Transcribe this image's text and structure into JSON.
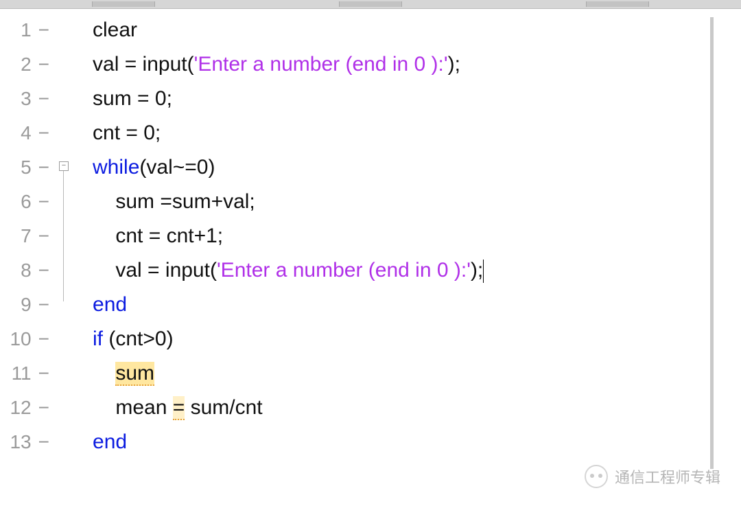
{
  "gutter": {
    "nums": [
      "1",
      "2",
      "3",
      "4",
      "5",
      "6",
      "7",
      "8",
      "9",
      "10",
      "11",
      "12",
      "13"
    ],
    "dash": "−"
  },
  "fold": {
    "minus": "−"
  },
  "code": {
    "l1": {
      "text": "clear"
    },
    "l2": {
      "a": "val = input(",
      "s": "'Enter a number (end in 0 ):'",
      "b": ");"
    },
    "l3": {
      "text": "sum = 0;"
    },
    "l4": {
      "text": "cnt = 0;"
    },
    "l5": {
      "kw": "while",
      "rest": "(val~=0)"
    },
    "l6": {
      "text": "sum =sum+val;"
    },
    "l7": {
      "text": "cnt = cnt+1;"
    },
    "l8": {
      "a": "val = input(",
      "s": "'Enter a number (end in 0 ):'",
      "b": ");"
    },
    "l9": {
      "kw": "end"
    },
    "l10": {
      "kw": "if ",
      "rest": "(cnt>0)"
    },
    "l11": {
      "hl": "sum"
    },
    "l12": {
      "a": "mean ",
      "hl": "=",
      "b": " sum/cnt"
    },
    "l13": {
      "kw": "end"
    }
  },
  "watermark": {
    "text": "通信工程师专辑"
  }
}
